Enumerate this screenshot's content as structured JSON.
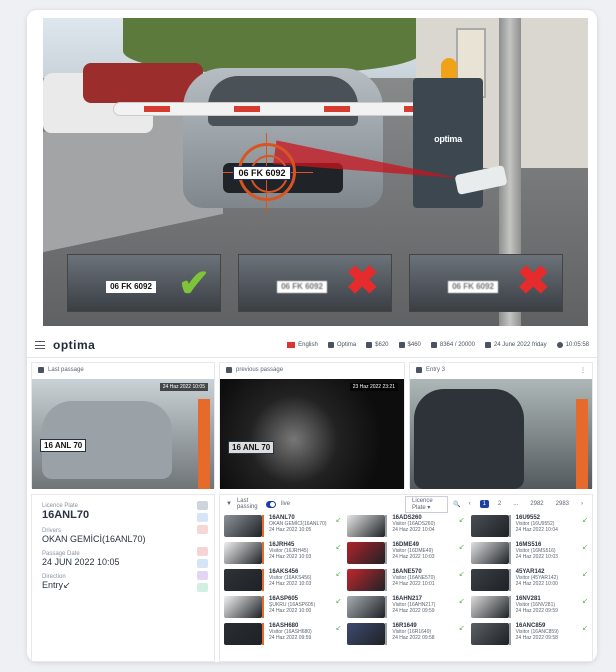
{
  "hero": {
    "box_label": "optima",
    "main_plate": "06 FK 6092",
    "thumbs": [
      {
        "plate": "06 FK 6092",
        "status": "check"
      },
      {
        "plate": "06 FK 6092",
        "status": "cross"
      },
      {
        "plate": "06 FK 6092",
        "status": "cross"
      }
    ]
  },
  "topbar": {
    "logo": "optima",
    "lang": "English",
    "user": "Optima",
    "cash": "$620",
    "trend": "$460",
    "capacity": "8364 / 20000",
    "date": "24 June 2022 friday",
    "time": "10:05:58"
  },
  "panels": {
    "last": {
      "title": "Last passage",
      "stamp": "24 Haz 2022 10:05",
      "plate": "16 ANL 70"
    },
    "prev": {
      "title": "previous passage",
      "stamp": "23 Haz 2022 23:21",
      "plate": "16 ANL 70"
    },
    "entry": {
      "title": "Entry 3"
    }
  },
  "info": {
    "plate_label": "Licence Plate",
    "plate": "16ANL70",
    "driver_label": "Drivers",
    "driver": "OKAN GEMİCİ(16ANL70)",
    "date_label": "Passage Date",
    "date": "24 JUN 2022 10:05",
    "dir_label": "Direction",
    "dir": "Entry↙"
  },
  "list": {
    "filter_label": "Last passing",
    "live_label": "live",
    "select_label": "Licence Plate",
    "pages": [
      "‹",
      "1",
      "2",
      "...",
      "2982",
      "2983",
      "›"
    ],
    "items": [
      {
        "plate": "16ANL70",
        "owner": "OKAN GEMİCİ(16ANL70)",
        "date": "24 Haz 2022 10:05",
        "color": "#8d939a"
      },
      {
        "plate": "16ADS260",
        "owner": "Visitor (16ADS260)",
        "date": "24 Haz 2022 10:04",
        "color": "#e6e6e6"
      },
      {
        "plate": "16U9552",
        "owner": "Visitor (16U9552)",
        "date": "24 Haz 2022 10:04",
        "color": "#4a4f55"
      },
      {
        "plate": "16JRH45",
        "owner": "Visitor (16JRH45)",
        "date": "24 Haz 2022 10:03",
        "color": "#f0f0f0"
      },
      {
        "plate": "16DME49",
        "owner": "Visitor (16DME49)",
        "date": "24 Haz 2022 10:03",
        "color": "#b0242b"
      },
      {
        "plate": "16MS516",
        "owner": "Visitor (16MS516)",
        "date": "24 Haz 2022 10:03",
        "color": "#e0e0e0"
      },
      {
        "plate": "16AKS456",
        "owner": "Visitor (16AKS456)",
        "date": "24 Haz 2022 10:03",
        "color": "#2f3338"
      },
      {
        "plate": "16ANE570",
        "owner": "Visitor (16ANE570)",
        "date": "24 Haz 2022 10:01",
        "color": "#c1272d"
      },
      {
        "plate": "45YAR142",
        "owner": "Visitor (45YAR142)",
        "date": "24 Haz 2022 10:00",
        "color": "#3a3f45"
      },
      {
        "plate": "16ASP605",
        "owner": "ŞUKRU (16ASP605)",
        "date": "24 Haz 2022 10:00",
        "color": "#f2f2f2"
      },
      {
        "plate": "16AHN217",
        "owner": "Visitor (16AHN217)",
        "date": "24 Haz 2022 09:59",
        "color": "#a8adb2"
      },
      {
        "plate": "16NV281",
        "owner": "Visitor (16NV281)",
        "date": "24 Haz 2022 09:59",
        "color": "#dcdcdc"
      },
      {
        "plate": "16ASH680",
        "owner": "Visitor (16ASH680)",
        "date": "24 Haz 2022 09:59",
        "color": "#2a2d31"
      },
      {
        "plate": "16R1649",
        "owner": "Visitor (16R1649)",
        "date": "24 Haz 2022 09:58",
        "color": "#3f4a70"
      },
      {
        "plate": "16ANC859",
        "owner": "Visitor (16ANC859)",
        "date": "24 Haz 2022 09:58",
        "color": "#5b6066"
      }
    ]
  }
}
